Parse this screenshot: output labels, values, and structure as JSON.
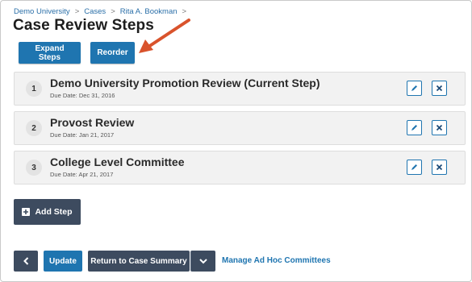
{
  "breadcrumb": {
    "items": [
      "Demo University",
      "Cases",
      "Rita A. Bookman"
    ],
    "separator": ">"
  },
  "page_title": "Case Review Steps",
  "toolbar": {
    "expand_label": "Expand Steps",
    "reorder_label": "Reorder"
  },
  "steps": [
    {
      "number": "1",
      "title": "Demo University Promotion Review",
      "badge": "(Current Step)",
      "due": "Due Date: Dec 31, 2016"
    },
    {
      "number": "2",
      "title": "Provost Review",
      "badge": "",
      "due": "Due Date: Jan 21, 2017"
    },
    {
      "number": "3",
      "title": "College Level Committee",
      "badge": "",
      "due": "Due Date: Apr 21, 2017"
    }
  ],
  "add_step_label": "Add Step",
  "footer": {
    "back_icon": "chevron-left-icon",
    "update_label": "Update",
    "return_label": "Return to Case Summary",
    "dropdown_icon": "chevron-down-icon",
    "manage_link": "Manage Ad Hoc Committees"
  },
  "colors": {
    "primary": "#1f75b0",
    "dark": "#3d4b5f",
    "arrow": "#d9532c"
  }
}
